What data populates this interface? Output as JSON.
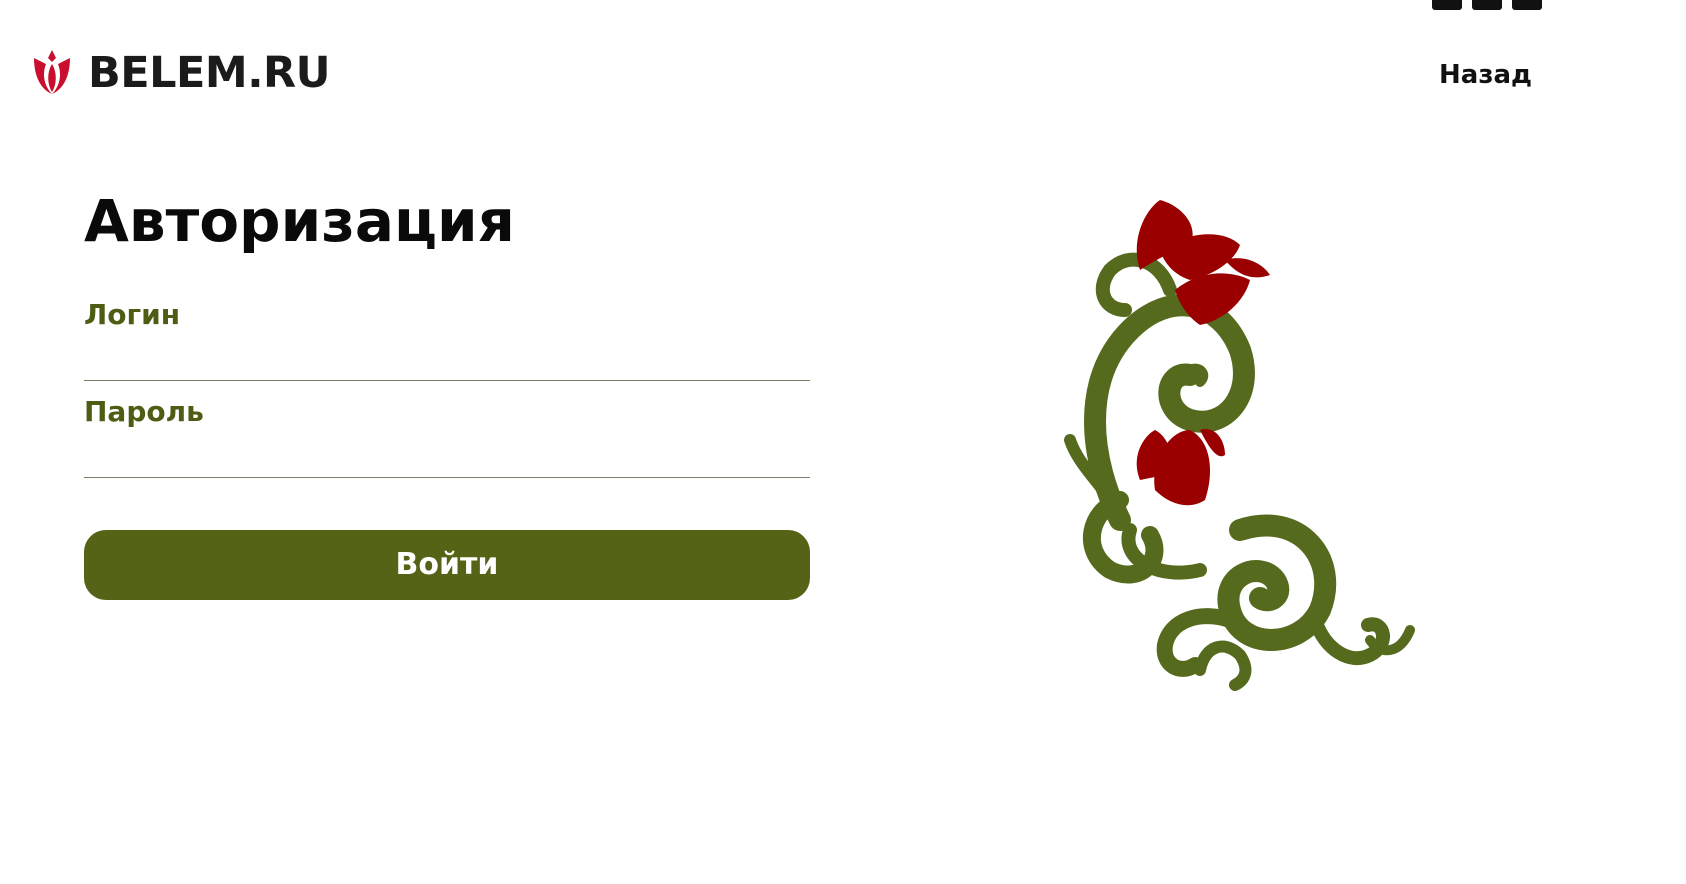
{
  "header": {
    "logo_text": "BELEM.RU",
    "back_label": "Назад"
  },
  "auth": {
    "title": "Авторизация",
    "login_label": "Логин",
    "login_value": "",
    "password_label": "Пароль",
    "password_value": "",
    "submit_label": "Войти"
  },
  "colors": {
    "accent_green": "#546316",
    "label_green": "#4e5d14",
    "tulip_red": "#9b0000",
    "logo_red": "#c8102e"
  },
  "icons": {
    "logo": "tulip-icon",
    "decoration": "tulip-ornament",
    "corner": [
      "window-icon",
      "window-icon",
      "window-icon"
    ]
  }
}
